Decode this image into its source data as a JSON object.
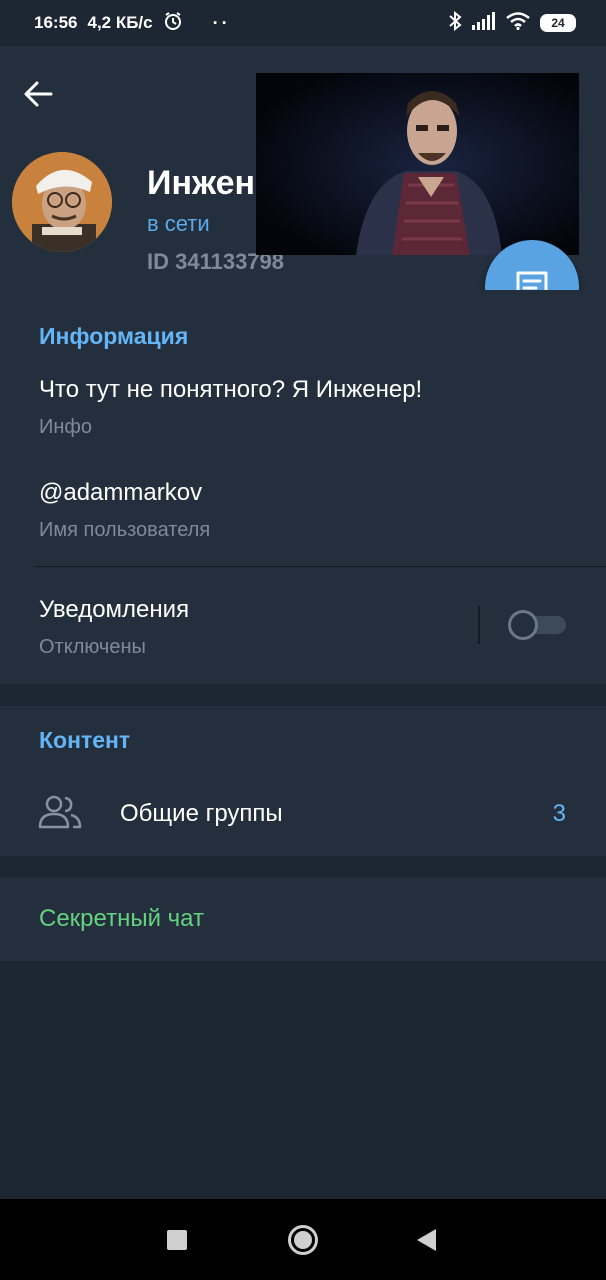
{
  "status_bar": {
    "time": "16:56",
    "speed": "4,2 КБ/с",
    "dots": "··",
    "battery": "24"
  },
  "profile": {
    "name": "Инжен",
    "status": "в сети",
    "id": "ID 341133798"
  },
  "info": {
    "title": "Информация",
    "bio": "Что тут не понятного? Я Инженер!",
    "bio_label": "Инфо",
    "username": "@adammarkov",
    "username_label": "Имя пользователя",
    "notifications": "Уведомления",
    "notifications_state": "Отключены"
  },
  "content": {
    "title": "Контент",
    "groups_label": "Общие группы",
    "groups_count": "3"
  },
  "secret_chat": "Секретный чат",
  "colors": {
    "background": "#1d2733",
    "section": "#242f3d",
    "accent_blue": "#64b5f6",
    "fab": "#5aa3e2",
    "green": "#66d17f"
  },
  "icons": [
    "back-arrow-icon",
    "alarm-icon",
    "bluetooth-icon",
    "signal-icon",
    "wifi-icon",
    "battery-icon",
    "message-icon",
    "groups-icon",
    "recent-apps-icon",
    "home-icon",
    "back-icon"
  ]
}
